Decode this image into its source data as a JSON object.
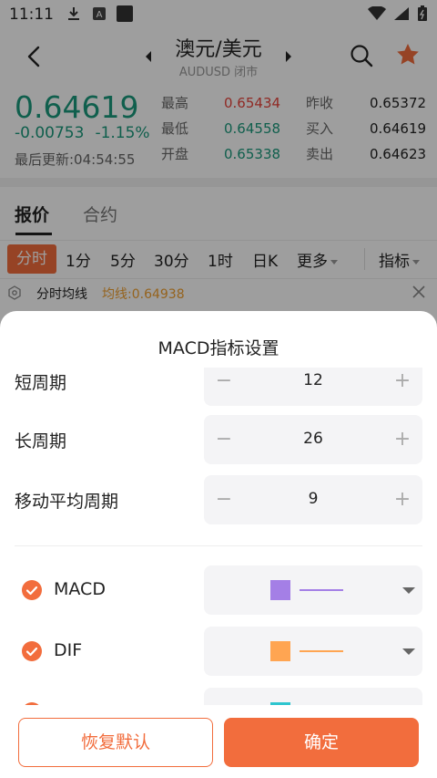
{
  "status_bar": {
    "time": "11:11"
  },
  "header": {
    "title": "澳元/美元",
    "subtitle": "AUDUSD 闭市"
  },
  "quote": {
    "price": "0.64619",
    "change": "-0.00753",
    "change_pct": "-1.15%",
    "last_update": "最后更新:04:54:55",
    "stats": [
      {
        "label": "最高",
        "value": "0.65434"
      },
      {
        "label": "最低",
        "value": "0.64558"
      },
      {
        "label": "开盘",
        "value": "0.65338"
      },
      {
        "label": "昨收",
        "value": "0.65372"
      },
      {
        "label": "买入",
        "value": "0.64619"
      },
      {
        "label": "卖出",
        "value": "0.64623"
      }
    ]
  },
  "tabs": [
    {
      "label": "报价"
    },
    {
      "label": "合约"
    }
  ],
  "periods": [
    {
      "label": "分时"
    },
    {
      "label": "1分"
    },
    {
      "label": "5分"
    },
    {
      "label": "30分"
    },
    {
      "label": "1时"
    },
    {
      "label": "日K"
    },
    {
      "label": "更多"
    },
    {
      "label": "指标"
    }
  ],
  "indicator_row": {
    "label": "分时均线",
    "value": "均线:0.64938"
  },
  "sheet": {
    "title": "MACD指标设置",
    "params": [
      {
        "label": "短周期",
        "value": "12"
      },
      {
        "label": "长周期",
        "value": "26"
      },
      {
        "label": "移动平均周期",
        "value": "9"
      }
    ],
    "minus": "−",
    "plus": "+",
    "lines": [
      {
        "label": "MACD",
        "color": "#a47fe6"
      },
      {
        "label": "DIF",
        "color": "#ffa552"
      },
      {
        "label": "",
        "color": "#2ec5cf"
      }
    ],
    "reset_label": "恢复默认",
    "confirm_label": "确定"
  }
}
